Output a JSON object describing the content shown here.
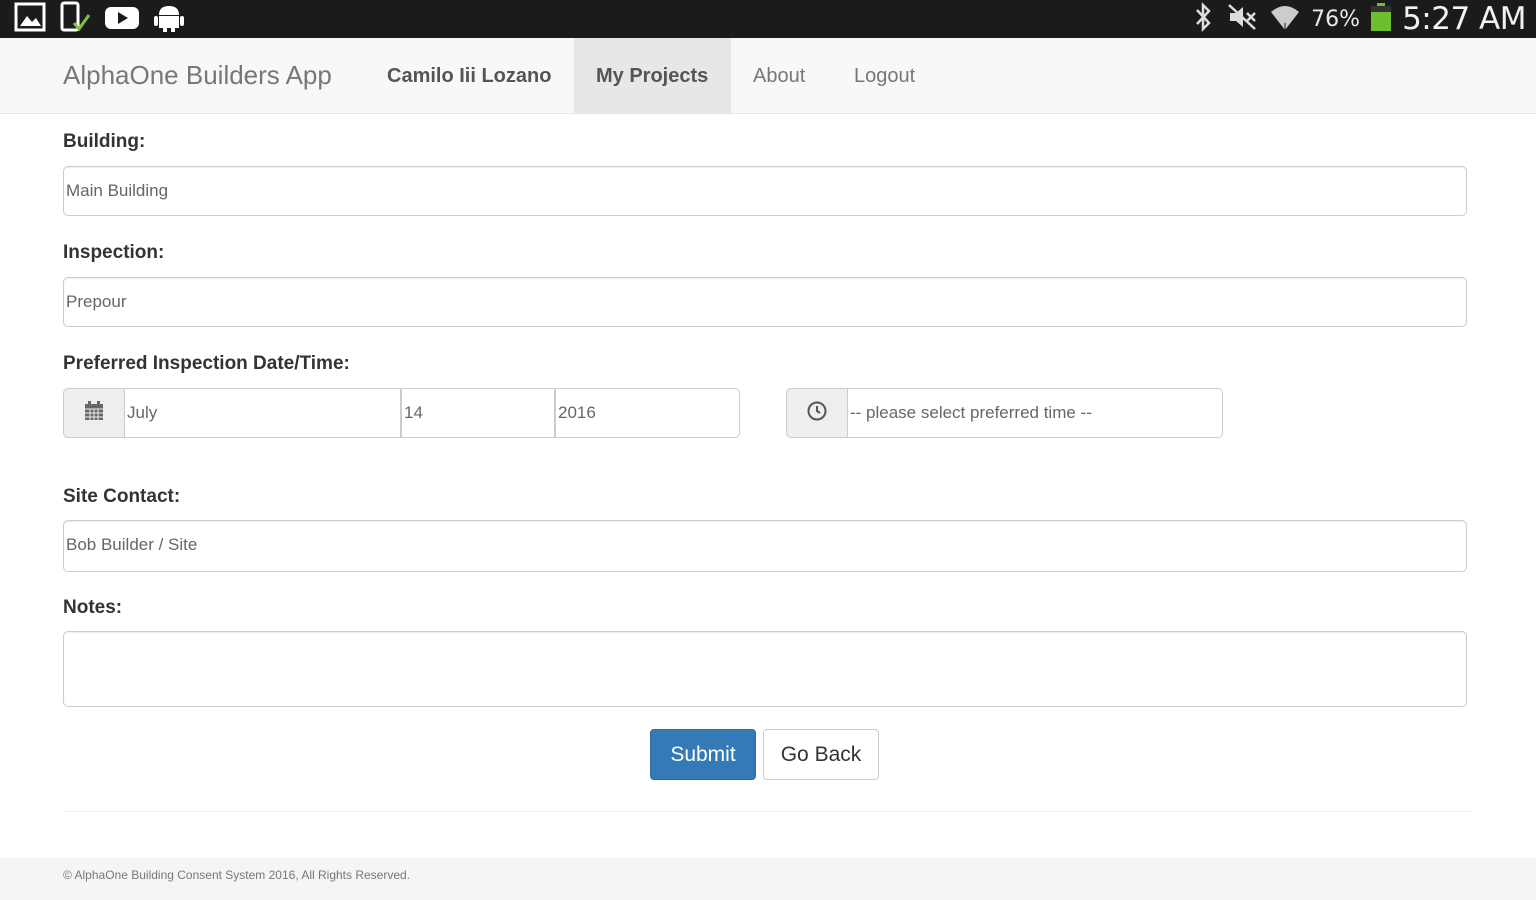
{
  "status_bar": {
    "left_icons": [
      "gallery-icon",
      "phone-check-icon",
      "youtube-icon",
      "android-icon"
    ],
    "right_icons": [
      "bluetooth-icon",
      "mute-icon",
      "wifi-icon",
      "battery-icon"
    ],
    "battery_percent": "76%",
    "battery_level": 0.76,
    "time": "5:27 AM",
    "battery_color": "#6cc02e"
  },
  "navbar": {
    "brand": "AlphaOne Builders App",
    "items": [
      {
        "label": "Camilo Iii Lozano"
      },
      {
        "label": "My Projects"
      },
      {
        "label": "About"
      },
      {
        "label": "Logout"
      }
    ]
  },
  "form": {
    "building": {
      "label": "Building:",
      "value": "Main Building"
    },
    "inspection": {
      "label": "Inspection:",
      "value": "Prepour"
    },
    "date_time": {
      "label": "Preferred Inspection Date/Time:",
      "month": "July",
      "day": "14",
      "year": "2016",
      "time_placeholder": "-- please select preferred time --"
    },
    "site_contact": {
      "label": "Site Contact:",
      "value": "Bob Builder / Site"
    },
    "notes": {
      "label": "Notes:",
      "value": ""
    },
    "submit_label": "Submit",
    "back_label": "Go Back"
  },
  "footer": {
    "text": "© AlphaOne Building Consent System 2016, All Rights Reserved."
  },
  "colors": {
    "primary": "#337ab7",
    "navbar_bg": "#f8f8f8",
    "active_tab_bg": "#e7e7e7"
  }
}
